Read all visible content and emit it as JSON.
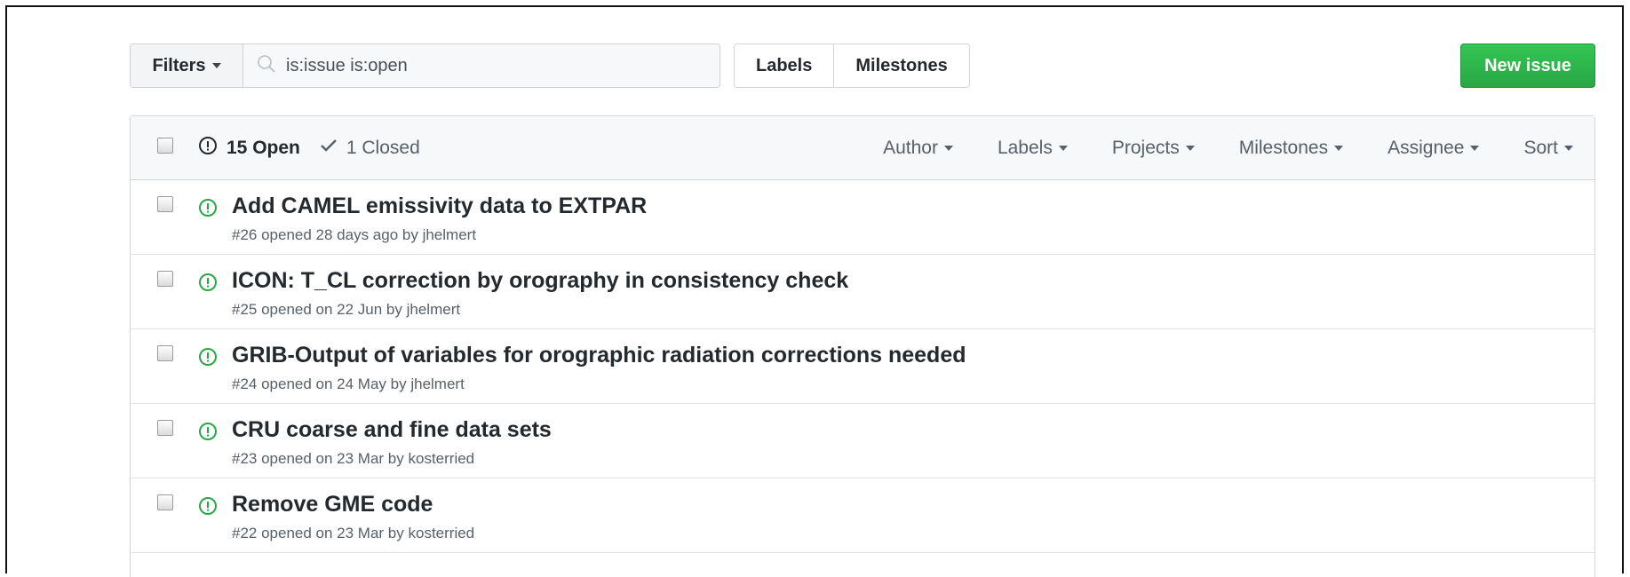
{
  "toolbar": {
    "filters_label": "Filters",
    "search_value": "is:issue is:open",
    "labels_label": "Labels",
    "milestones_label": "Milestones",
    "new_issue_label": "New issue"
  },
  "header": {
    "open_label": "15 Open",
    "closed_label": "1 Closed",
    "menus": [
      "Author",
      "Labels",
      "Projects",
      "Milestones",
      "Assignee",
      "Sort"
    ]
  },
  "issues": [
    {
      "title": "Add CAMEL emissivity data to EXTPAR",
      "meta": "#26 opened 28 days ago by",
      "author": "jhelmert"
    },
    {
      "title": "ICON: T_CL correction by orography in consistency check",
      "meta": "#25 opened on 22 Jun by",
      "author": "jhelmert"
    },
    {
      "title": "GRIB-Output of variables for orographic radiation corrections needed",
      "meta": "#24 opened on 24 May by",
      "author": "jhelmert"
    },
    {
      "title": "CRU coarse and fine data sets",
      "meta": "#23 opened on 23 Mar by",
      "author": "kosterried"
    },
    {
      "title": "Remove GME code",
      "meta": "#22 opened on 23 Mar by",
      "author": "kosterried"
    }
  ],
  "colors": {
    "open_icon": "#28a745",
    "new_issue_bg": "#2ebc4f"
  },
  "icons": [
    "search-icon",
    "issue-opened-icon",
    "check-icon",
    "caret-down-icon",
    "checkbox"
  ]
}
